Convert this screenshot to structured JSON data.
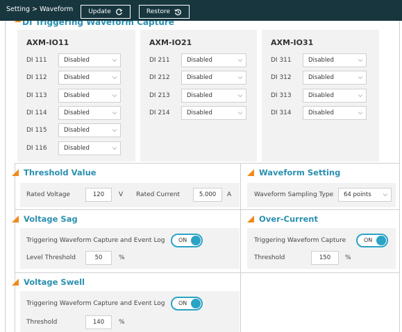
{
  "header": {
    "breadcrumb": "Setting > Waveform",
    "update_label": "Update",
    "restore_label": "Restore"
  },
  "top_section": {
    "title_partial": "DI Triggering Waveform Capture"
  },
  "modules": [
    {
      "name": "AXM-IO11",
      "rows": [
        {
          "label": "DI 111",
          "value": "Disabled"
        },
        {
          "label": "DI 112",
          "value": "Disabled"
        },
        {
          "label": "DI 113",
          "value": "Disabled"
        },
        {
          "label": "DI 114",
          "value": "Disabled"
        },
        {
          "label": "DI 115",
          "value": "Disabled"
        },
        {
          "label": "DI 116",
          "value": "Disabled"
        }
      ]
    },
    {
      "name": "AXM-IO21",
      "rows": [
        {
          "label": "DI 211",
          "value": "Disabled"
        },
        {
          "label": "DI 212",
          "value": "Disabled"
        },
        {
          "label": "DI 213",
          "value": "Disabled"
        },
        {
          "label": "DI 214",
          "value": "Disabled"
        }
      ]
    },
    {
      "name": "AXM-IO31",
      "rows": [
        {
          "label": "DI 311",
          "value": "Disabled"
        },
        {
          "label": "DI 312",
          "value": "Disabled"
        },
        {
          "label": "DI 313",
          "value": "Disabled"
        },
        {
          "label": "DI 314",
          "value": "Disabled"
        }
      ]
    }
  ],
  "threshold_value": {
    "title": "Threshold Value",
    "rated_voltage_label": "Rated Voltage",
    "rated_voltage_value": "120",
    "rated_voltage_unit": "V",
    "rated_current_label": "Rated Current",
    "rated_current_value": "5.000",
    "rated_current_unit": "A"
  },
  "waveform_setting": {
    "title": "Waveform Setting",
    "sampling_label": "Waveform Sampling Type",
    "sampling_value": "64 points"
  },
  "voltage_sag": {
    "title": "Voltage Sag",
    "trigger_label": "Triggering Waveform Capture and Event Log",
    "toggle_label": "ON",
    "level_label": "Level Threshold",
    "level_value": "50",
    "level_unit": "%"
  },
  "over_current": {
    "title": "Over-Current",
    "trigger_label": "Triggering Waveform Capture",
    "toggle_label": "ON",
    "threshold_label": "Threshold",
    "threshold_value": "150",
    "threshold_unit": "%"
  },
  "voltage_swell": {
    "title": "Voltage Swell",
    "trigger_label": "Triggering Waveform Capture and Event Log",
    "toggle_label": "ON",
    "threshold_label": "Threshold",
    "threshold_value": "140",
    "threshold_unit": "%"
  },
  "colors": {
    "topbar": "#17363e",
    "accent": "#2a8fb0",
    "triangle": "#f08a1c",
    "toggle": "#2aa3c5",
    "panel_bg": "#f2f2f2"
  },
  "icons": {
    "update": "refresh-icon",
    "restore": "history-icon",
    "section": "orange-triangle-icon",
    "dropdown": "chevron-down-icon"
  }
}
